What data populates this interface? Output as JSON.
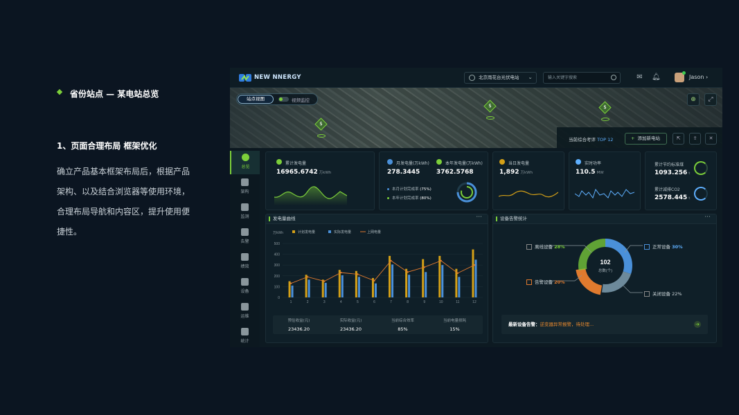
{
  "slide": {
    "heading": "省份站点 — 某电站总览",
    "subheading": "1、页面合理布局 框架优化",
    "paragraph": "确立产品基本框架布局后，根据产品\n架构、以及结合浏览器等使用环境，\n合理布局导航和内容区，提升使用便\n捷性。"
  },
  "app": {
    "brand": "NEW NNERGY",
    "station_select": "北京雨花台光伏电站",
    "search_placeholder": "输入关键字搜索",
    "user_name": "Jason",
    "accent": "#7ccf3a"
  },
  "map": {
    "tab_active": "站点视图",
    "tab_toggle": "视频监控",
    "pin_label": "$",
    "ranking_prefix": "当前综合考评",
    "ranking_value": "TOP 12",
    "add_station": "添加新电站"
  },
  "nav": [
    "总览",
    "架构",
    "监测",
    "告警",
    "绩效",
    "设备",
    "运维",
    "统计"
  ],
  "cards": {
    "total": {
      "label": "累计发电量",
      "value": "16965.6742",
      "unit": "万kWh"
    },
    "monthly": {
      "label": "月发电量(万kWh)",
      "value": "278.3445"
    },
    "yearly": {
      "label": "本年发电量(万kWh)",
      "value": "3762.5768"
    },
    "month_rate": {
      "label": "本月计划完成率",
      "value": "(75%)"
    },
    "year_rate": {
      "label": "本年计划完成率",
      "value": "(80%)"
    },
    "daily": {
      "label": "当日发电量",
      "value": "1,892",
      "unit": "万kWh"
    },
    "power": {
      "label": "实时功率",
      "value": "110.5",
      "unit": "MW"
    },
    "coal": {
      "label": "累计节约标准煤",
      "value": "1093.256",
      "unit": "t"
    },
    "co2": {
      "label": "累计减排CO2",
      "value": "2578.445",
      "unit": "t"
    }
  },
  "power_panel": {
    "title": "发电量曲线",
    "unit_label": "万kWh",
    "legend": [
      "计划发电量",
      "实际发电量",
      "上网电量"
    ],
    "stat_headers": [
      "预估收益(元)",
      "实际收益(元)",
      "当前综合效率",
      "当前电量损耗"
    ],
    "stat_values": [
      "23436.20",
      "23436.20",
      "85%",
      "15%"
    ]
  },
  "chart_data": {
    "type": "bar",
    "categories": [
      "1",
      "2",
      "3",
      "4",
      "5",
      "6",
      "7",
      "8",
      "9",
      "10",
      "11",
      "12"
    ],
    "ylim": [
      0,
      500
    ],
    "yticks": [
      "500",
      "400",
      "300",
      "200",
      "100",
      "0"
    ],
    "series": [
      {
        "name": "计划发电量",
        "color": "#d4a017",
        "values": [
          150,
          210,
          165,
          255,
          245,
          180,
          385,
          265,
          355,
          385,
          265,
          445
        ]
      },
      {
        "name": "实际发电量",
        "color": "#4a90d9",
        "values": [
          110,
          165,
          135,
          205,
          190,
          130,
          305,
          210,
          235,
          300,
          190,
          350
        ]
      },
      {
        "name": "上网电量",
        "color": "#e07a2e",
        "values": [
          130,
          190,
          150,
          230,
          215,
          155,
          340,
          235,
          280,
          340,
          225,
          300
        ]
      }
    ]
  },
  "alarm_panel": {
    "title": "设备告警统计",
    "total": "102",
    "total_label": "总数(个)",
    "offline": {
      "label": "离线设备",
      "pct": "28%"
    },
    "alarm": {
      "label": "告警设备",
      "pct": "20%"
    },
    "normal": {
      "label": "正常设备",
      "pct": "30%"
    },
    "closed": {
      "label": "关闭设备",
      "pct": "22%"
    },
    "latest_label": "最新设备告警：",
    "latest_text": "逆变器异常报警，待处理..."
  }
}
